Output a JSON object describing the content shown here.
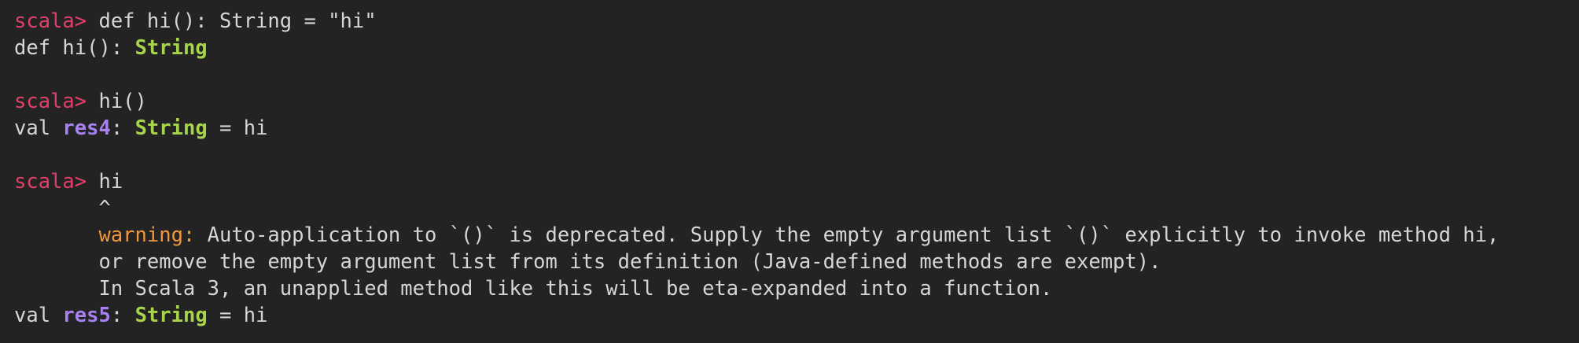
{
  "terminal": {
    "prompt": "scala> ",
    "lines": {
      "l1_cmd": "def hi(): String = \"hi\"",
      "l2_pre": "def hi(): ",
      "l2_type": "String",
      "l4_cmd": "hi()",
      "l5_val": "val ",
      "l5_name": "res4",
      "l5_colon": ": ",
      "l5_type": "String",
      "l5_eq": " = hi",
      "l7_cmd": "hi",
      "l8_caret": "       ^",
      "l9_indent": "       ",
      "l9_label": "warning:",
      "l9_text": " Auto-application to `()` is deprecated. Supply the empty argument list `()` explicitly to invoke method hi,",
      "l10_text": "       or remove the empty argument list from its definition (Java-defined methods are exempt).",
      "l11_text": "       In Scala 3, an unapplied method like this will be eta-expanded into a function.",
      "l12_val": "val ",
      "l12_name": "res5",
      "l12_colon": ": ",
      "l12_type": "String",
      "l12_eq": " = hi"
    }
  },
  "colors": {
    "background": "#232323",
    "text": "#d6d6d6",
    "prompt": "#e2406b",
    "type": "#a8d44c",
    "identifier": "#a880f0",
    "warning": "#f0983a"
  }
}
